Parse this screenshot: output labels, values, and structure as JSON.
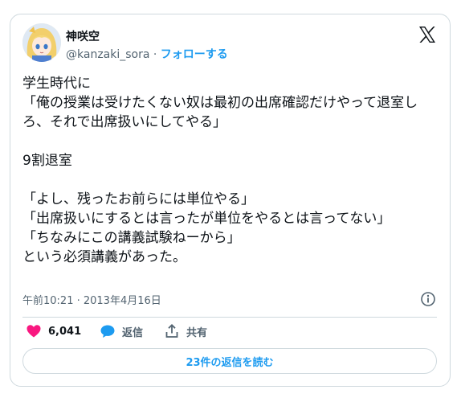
{
  "user": {
    "display_name": "神咲空",
    "handle": "@kanzaki_sora",
    "separator": "·",
    "follow_label": "フォローする"
  },
  "tweet": {
    "text": "学生時代に\n「俺の授業は受けたくない奴は最初の出席確認だけやって退室しろ、それで出席扱いにしてやる」\n\n9割退室\n\n「よし、残ったお前らには単位やる」\n「出席扱いにするとは言ったが単位をやるとは言ってない」\n「ちなみにこの講義試験ねーから」\nという必須講義があった。",
    "timestamp": "午前10:21 · 2013年4月16日"
  },
  "actions": {
    "likes": "6,041",
    "reply_label": "返信",
    "share_label": "共有"
  },
  "read_replies_label": "23件の返信を読む",
  "icons": {
    "brand": "x-logo-icon",
    "info": "info-icon",
    "like": "heart-icon",
    "reply": "speech-bubble-icon",
    "share": "share-icon"
  },
  "colors": {
    "like": "#f91880",
    "reply": "#1d9bf0",
    "link": "#1d9bf0",
    "text": "#0f1419",
    "secondary": "#536471",
    "border": "#cfd9de"
  }
}
